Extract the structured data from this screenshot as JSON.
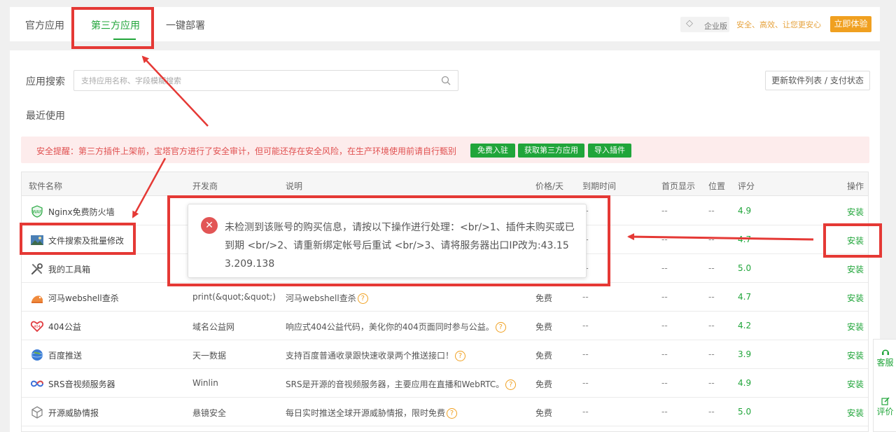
{
  "tabs": [
    {
      "label": "官方应用",
      "active": false
    },
    {
      "label": "第三方应用",
      "active": true
    },
    {
      "label": "一键部署",
      "active": false
    }
  ],
  "enterprise": {
    "badge": "企业版",
    "badge_icon": "diamond-icon",
    "slogan": "安全、高效、让您更安心",
    "button": "立即体验"
  },
  "search": {
    "label": "应用搜索",
    "placeholder": "支持应用名称、字段模糊搜索",
    "value": "",
    "refresh_button": "更新软件列表 / 支付状态"
  },
  "recent_label": "最近使用",
  "alert": {
    "text": "安全提醒：第三方插件上架前，宝塔官方进行了安全审计，但可能还存在安全风险，在生产环境使用前请自行甄别",
    "buttons": [
      "免费入驻",
      "获取第三方应用",
      "导入插件"
    ]
  },
  "table": {
    "headers": [
      "软件名称",
      "开发商",
      "说明",
      "价格/天",
      "到期时间",
      "首页显示",
      "位置",
      "评分",
      "操作"
    ],
    "rows": [
      {
        "icon": "waf-icon",
        "name": "Nginx免费防火墙",
        "developer": "",
        "desc": "",
        "price": "",
        "expire": "--",
        "home": "--",
        "pos": "--",
        "score": "4.9",
        "op": "安装"
      },
      {
        "icon": "image-thumb-icon",
        "name": "文件搜索及批量修改",
        "developer": "",
        "desc": "",
        "price": "",
        "expire": "--",
        "home": "--",
        "pos": "--",
        "score": "4.7",
        "op": "安装"
      },
      {
        "icon": "tools-icon",
        "name": "我的工具箱",
        "developer": "",
        "desc": "",
        "price": "",
        "expire": "--",
        "home": "--",
        "pos": "--",
        "score": "5.0",
        "op": "安装"
      },
      {
        "icon": "hippo-icon",
        "name": "河马webshell查杀",
        "developer": "print(&quot;&quot;)",
        "desc": "河马webshell查杀",
        "price": "免费",
        "expire": "--",
        "home": "--",
        "pos": "--",
        "score": "4.7",
        "op": "安装"
      },
      {
        "icon": "heart-icon",
        "name": "404公益",
        "developer": "域名公益网",
        "desc": "响应式404公益代码，美化你的404页面同时参与公益。",
        "price": "免费",
        "expire": "--",
        "home": "--",
        "pos": "--",
        "score": "4.2",
        "op": "安装"
      },
      {
        "icon": "globe-icon",
        "name": "百度推送",
        "developer": "天一数据",
        "desc": "支持百度普通收录跟快速收录两个推送接口！",
        "price": "免费",
        "expire": "--",
        "home": "--",
        "pos": "--",
        "score": "3.9",
        "op": "安装"
      },
      {
        "icon": "infinity-icon",
        "name": "SRS音视频服务器",
        "developer": "Winlin",
        "desc": "SRS是开源的音视频服务器，主要应用在直播和WebRTC。",
        "price": "免费",
        "expire": "--",
        "home": "--",
        "pos": "--",
        "score": "4.9",
        "op": "安装"
      },
      {
        "icon": "cube-icon",
        "name": "开源威胁情报",
        "developer": "悬镜安全",
        "desc": "每日实时推送全球开源威胁情报，限时免费",
        "price": "免费",
        "expire": "--",
        "home": "--",
        "pos": "--",
        "score": "5.0",
        "op": "安装"
      }
    ]
  },
  "dialog": {
    "icon": "error-icon",
    "message": "未检测到该账号的购买信息，请按以下操作进行处理：<br/>1、插件未购买或已到期 <br/>2、请重新绑定帐号后重试 <br/>3、请将服务器出口IP改为:43.153.209.138"
  },
  "side": {
    "items": [
      {
        "icon": "headset-icon",
        "label": "客服"
      },
      {
        "icon": "edit-icon",
        "label": "评价"
      }
    ]
  },
  "colors": {
    "accent": "#20a53a",
    "annotation": "#e53935",
    "warning": "#f0a020",
    "error": "#e25555"
  }
}
